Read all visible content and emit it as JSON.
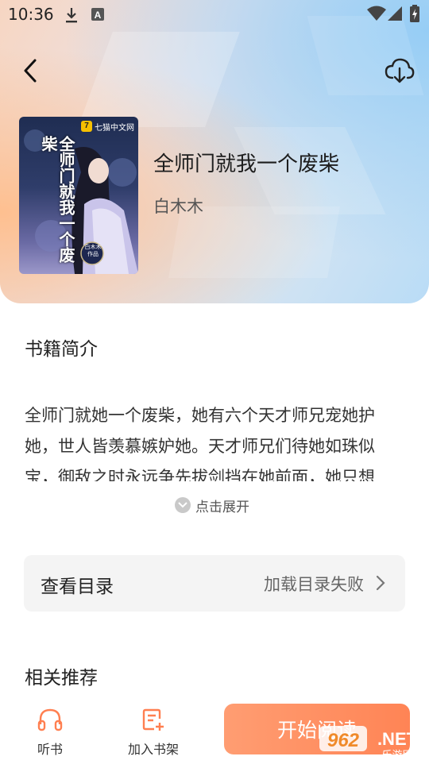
{
  "status_bar": {
    "time": "10:36",
    "icons": [
      "download-icon",
      "text-a-icon",
      "wifi-icon",
      "cellular-icon",
      "battery-charging-icon"
    ]
  },
  "nav": {
    "back_icon": "back-arrow-icon",
    "download_icon": "cloud-download-icon"
  },
  "book": {
    "title": "全师门就我一个废柴",
    "author": "白木木",
    "cover": {
      "publisher_badge": "七猫中文网",
      "cover_title": "全师门就我一个废柴",
      "author_seal": "白木木 作品"
    }
  },
  "intro": {
    "heading": "书籍简介",
    "text": "全师门就她一个废柴，她有六个天才师兄宠她护她，世人皆羡慕嫉妒她。天才师兄们待她如珠似宝，御敌之时永远争先拔剑挡在她前面，她只想",
    "expand_label": "点击展开"
  },
  "catalog": {
    "label": "查看目录",
    "status": "加载目录失败"
  },
  "related": {
    "heading": "相关推荐"
  },
  "bottom_bar": {
    "listen_label": "听书",
    "shelf_label": "加入书架",
    "read_label": "开始阅读"
  },
  "watermark": {
    "text": "962.NET",
    "sub": "乐游网"
  },
  "colors": {
    "accent": "#ff8a5c",
    "catalog_bg": "#f4f4f4"
  }
}
